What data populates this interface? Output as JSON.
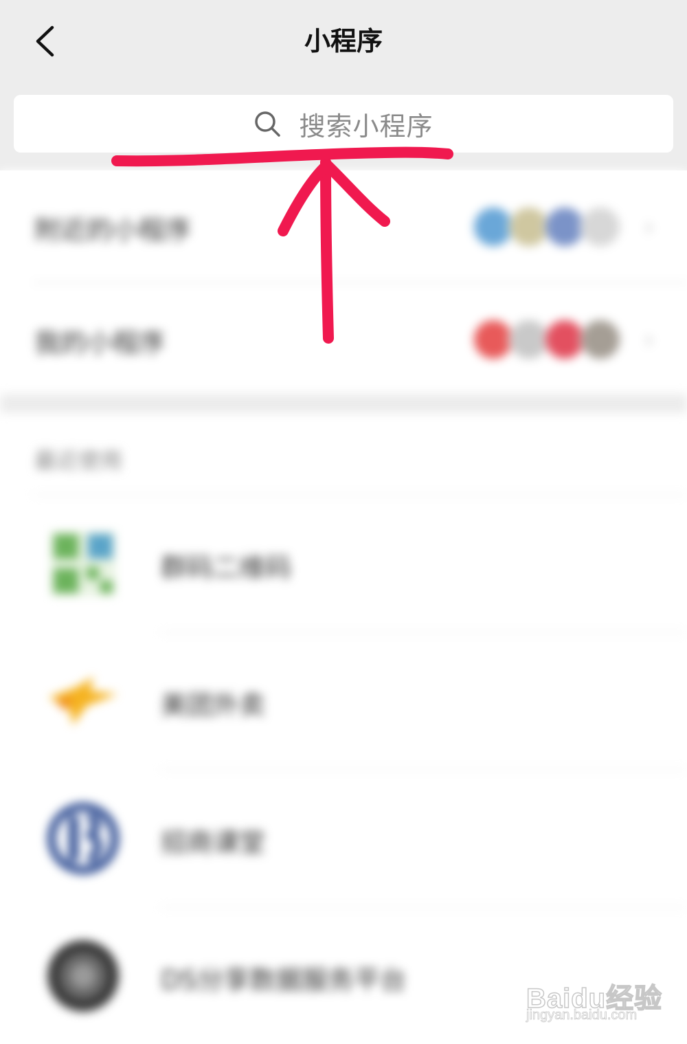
{
  "header": {
    "title": "小程序",
    "back_icon": "chevron-left-icon"
  },
  "search": {
    "placeholder": "搜索小程序",
    "icon": "search-icon"
  },
  "menu": [
    {
      "label": "附近的小程序",
      "icon": "chevron-right-icon",
      "avatar_colors": [
        "#6aa7d8",
        "#cfc7a0",
        "#7b93c8",
        "#d7d7d7"
      ]
    },
    {
      "label": "我的小程序",
      "icon": "chevron-right-icon",
      "avatar_colors": [
        "#e85a5a",
        "#c9c9c9",
        "#e35060",
        "#a59e95"
      ]
    }
  ],
  "recent": {
    "header": "最近使用",
    "apps": [
      {
        "name": "群码二维码",
        "icon": "qr-code-app-icon",
        "color": "#6cb35c"
      },
      {
        "name": "美团外卖",
        "icon": "kangaroo-app-icon",
        "color": "#f5b321"
      },
      {
        "name": "招商课堂",
        "icon": "circle-logo-app-icon",
        "color": "#2e4c92"
      },
      {
        "name": "DS分享数据服务平台",
        "icon": "dark-circle-app-icon",
        "color": "#3a3a3a"
      }
    ]
  },
  "annotation": {
    "color": "#f0194f"
  },
  "watermark": {
    "brand": "Baidu经验",
    "url": "jingyan.baidu.com"
  }
}
